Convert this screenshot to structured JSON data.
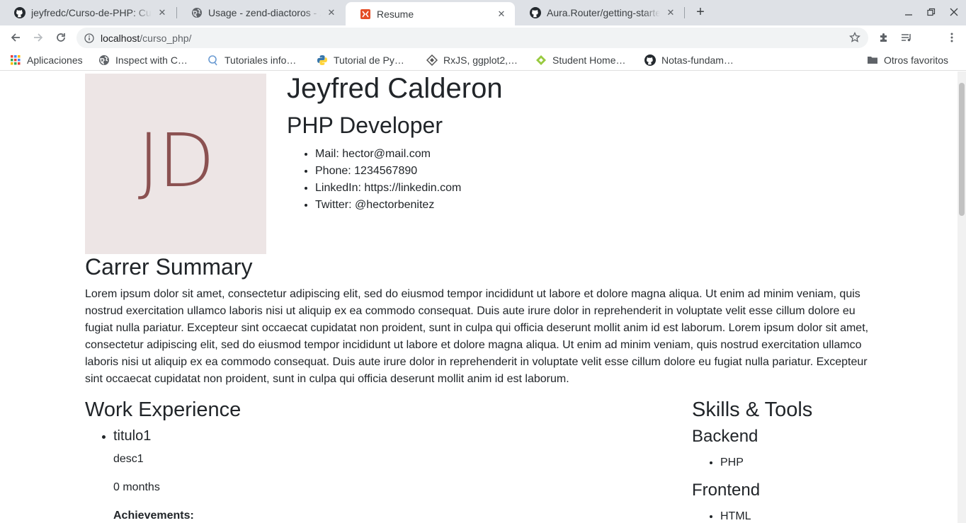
{
  "browser": {
    "tabs": [
      {
        "title": "jeyfredc/Curso-de-PHP: Cu",
        "icon": "github-icon"
      },
      {
        "title": "Usage - zend-diactoros - Ze",
        "icon": "globe-icon"
      },
      {
        "title": "Resume",
        "icon": "html5-icon",
        "active": true
      },
      {
        "title": "Aura.Router/getting-starte",
        "icon": "github-icon"
      }
    ],
    "url_host": "localhost",
    "url_path": "/curso_php/",
    "bookmarks": [
      {
        "label": "Aplicaciones",
        "icon": "apps-grid-icon"
      },
      {
        "label": "Inspect with C…",
        "icon": "globe-icon"
      },
      {
        "label": "Tutoriales info…",
        "icon": "search-bubble-icon"
      },
      {
        "label": "Tutorial de Py…",
        "icon": "python-icon"
      },
      {
        "label": "RxJS, ggplot2,…",
        "icon": "diamond-icon"
      },
      {
        "label": "Student Home…",
        "icon": "green-diamond-icon"
      },
      {
        "label": "Notas-fundam…",
        "icon": "github-icon"
      }
    ],
    "other_bookmarks": "Otros favoritos"
  },
  "resume": {
    "initials": "JD",
    "name": "Jeyfred Calderon",
    "role": "PHP Developer",
    "contacts": [
      "Mail: hector@mail.com",
      "Phone: 1234567890",
      "LinkedIn: https://linkedin.com",
      "Twitter: @hectorbenitez"
    ],
    "summary_heading": "Carrer Summary",
    "summary": "Lorem ipsum dolor sit amet, consectetur adipiscing elit, sed do eiusmod tempor incididunt ut labore et dolore magna aliqua. Ut enim ad minim veniam, quis nostrud exercitation ullamco laboris nisi ut aliquip ex ea commodo consequat. Duis aute irure dolor in reprehenderit in voluptate velit esse cillum dolore eu fugiat nulla pariatur. Excepteur sint occaecat cupidatat non proident, sunt in culpa qui officia deserunt mollit anim id est laborum. Lorem ipsum dolor sit amet, consectetur adipiscing elit, sed do eiusmod tempor incididunt ut labore et dolore magna aliqua. Ut enim ad minim veniam, quis nostrud exercitation ullamco laboris nisi ut aliquip ex ea commodo consequat. Duis aute irure dolor in reprehenderit in voluptate velit esse cillum dolore eu fugiat nulla pariatur. Excepteur sint occaecat cupidatat non proident, sunt in culpa qui officia deserunt mollit anim id est laborum.",
    "work_heading": "Work Experience",
    "job": {
      "title": "titulo1",
      "description": "desc1",
      "duration": "0 months",
      "achievements_label": "Achievements:"
    },
    "skills_heading": "Skills & Tools",
    "backend_heading": "Backend",
    "backend_items": [
      "PHP"
    ],
    "frontend_heading": "Frontend",
    "frontend_items": [
      "HTML"
    ]
  }
}
